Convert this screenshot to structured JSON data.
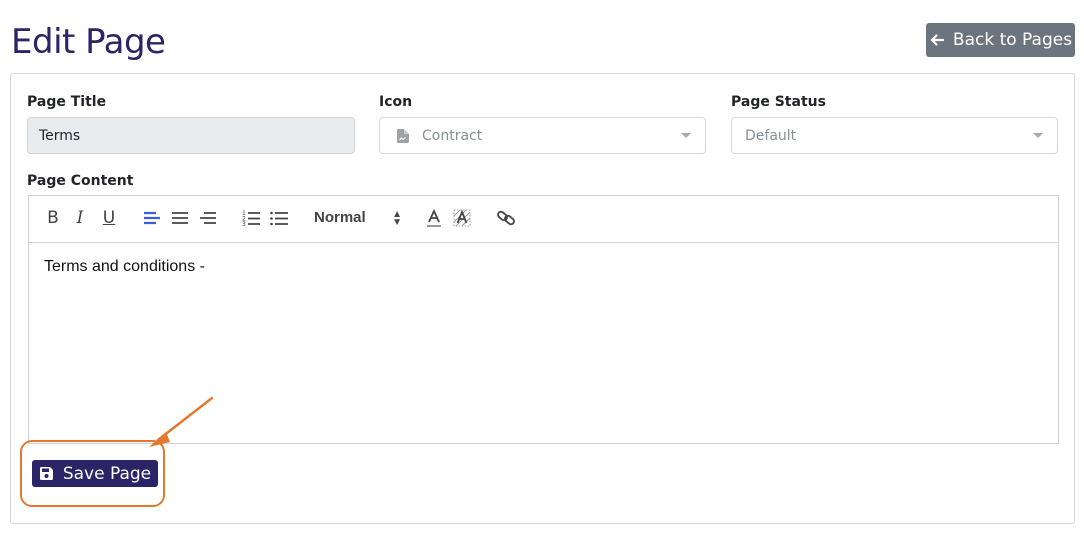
{
  "header": {
    "title": "Edit Page",
    "back_button_label": "Back to Pages"
  },
  "form": {
    "page_title": {
      "label": "Page Title",
      "value": "Terms"
    },
    "icon": {
      "label": "Icon",
      "value": "Contract",
      "icon_name": "file-contract-icon"
    },
    "page_status": {
      "label": "Page Status",
      "value": "Default"
    },
    "page_content": {
      "label": "Page Content",
      "toolbar": {
        "bold": "B",
        "italic": "I",
        "underline": "U",
        "header_select": "Normal"
      },
      "body_text": "Terms and conditions -"
    },
    "save_button_label": "Save Page"
  },
  "colors": {
    "brand": "#2b2466",
    "secondary_button": "#6c757d",
    "annotation": "#e2792f",
    "active_tool": "#3d5fd6"
  }
}
